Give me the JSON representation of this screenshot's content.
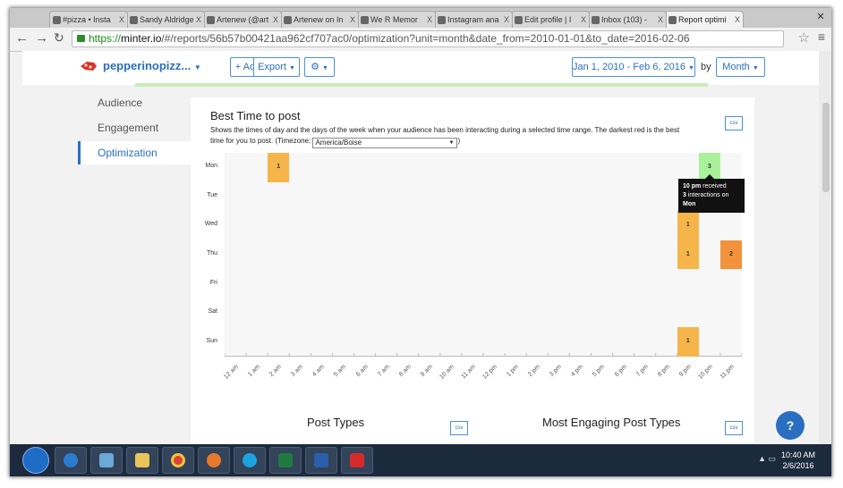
{
  "browser": {
    "tabs": [
      {
        "label": "#pizza • Insta"
      },
      {
        "label": "Sandy Aldridge"
      },
      {
        "label": "Artenew (@art"
      },
      {
        "label": "Artenew on In"
      },
      {
        "label": "We R Memor"
      },
      {
        "label": "Instagram ana"
      },
      {
        "label": "Edit profile | I"
      },
      {
        "label": "Inbox (103) -"
      },
      {
        "label": "Report optimi",
        "active": true
      }
    ],
    "tab_close": "X",
    "url_scheme": "https://",
    "url_host": "minter.io",
    "url_path": "/#/reports/56b57b00421aa962cf707ac0/optimization?unit=month&date_from=2010-01-01&to_date=2016-02-06"
  },
  "header": {
    "brand": "pepperinopizz...",
    "add_label": "+ Add",
    "export_label": "Export",
    "settings_label": "⚙",
    "date_range": "Jan 1, 2010 - Feb 6, 2016",
    "by_label": "by",
    "unit": "Month"
  },
  "sidebar": {
    "items": [
      {
        "label": "Audience"
      },
      {
        "label": "Engagement"
      },
      {
        "label": "Optimization",
        "active": true
      }
    ]
  },
  "card": {
    "title": "Best Time to post",
    "description": "Shows the times of day and the days of the week when your audience has been interacting during a selected time range. The darkest red is the best time for you to post. (Timezone:",
    "timezone": "America/Boise",
    "csv_label": "csv"
  },
  "chart_data": {
    "type": "heatmap",
    "y": [
      "Mon",
      "Tue",
      "Wed",
      "Thu",
      "Fri",
      "Sat",
      "Sun"
    ],
    "x": [
      "12 am",
      "1 am",
      "2 am",
      "3 am",
      "4 am",
      "5 am",
      "6 am",
      "7 am",
      "8 am",
      "9 am",
      "10 am",
      "11 am",
      "12 pm",
      "1 pm",
      "2 pm",
      "3 pm",
      "4 pm",
      "5 pm",
      "6 pm",
      "7 pm",
      "8 pm",
      "9 pm",
      "10 pm",
      "11 pm"
    ],
    "cells": [
      {
        "day": "Mon",
        "hour": "2 am",
        "value": 1,
        "color": "#f6b54a"
      },
      {
        "day": "Mon",
        "hour": "10 pm",
        "value": 3,
        "color": "#a9f29a"
      },
      {
        "day": "Wed",
        "hour": "9 pm",
        "value": 1,
        "color": "#f6b54a"
      },
      {
        "day": "Thu",
        "hour": "9 pm",
        "value": 1,
        "color": "#f6b54a"
      },
      {
        "day": "Thu",
        "hour": "11 pm",
        "value": 2,
        "color": "#f2923a"
      },
      {
        "day": "Sun",
        "hour": "9 pm",
        "value": 1,
        "color": "#f6b54a"
      }
    ]
  },
  "tooltip": {
    "time": "10 pm",
    "received": " received",
    "count": "3",
    "interactions": " interactions on",
    "day": "Mon"
  },
  "sections": {
    "post_types": "Post Types",
    "most_engaging": "Most Engaging Post Types"
  },
  "help_label": "?",
  "taskbar": {
    "time": "10:40 AM",
    "date": "2/6/2016"
  }
}
